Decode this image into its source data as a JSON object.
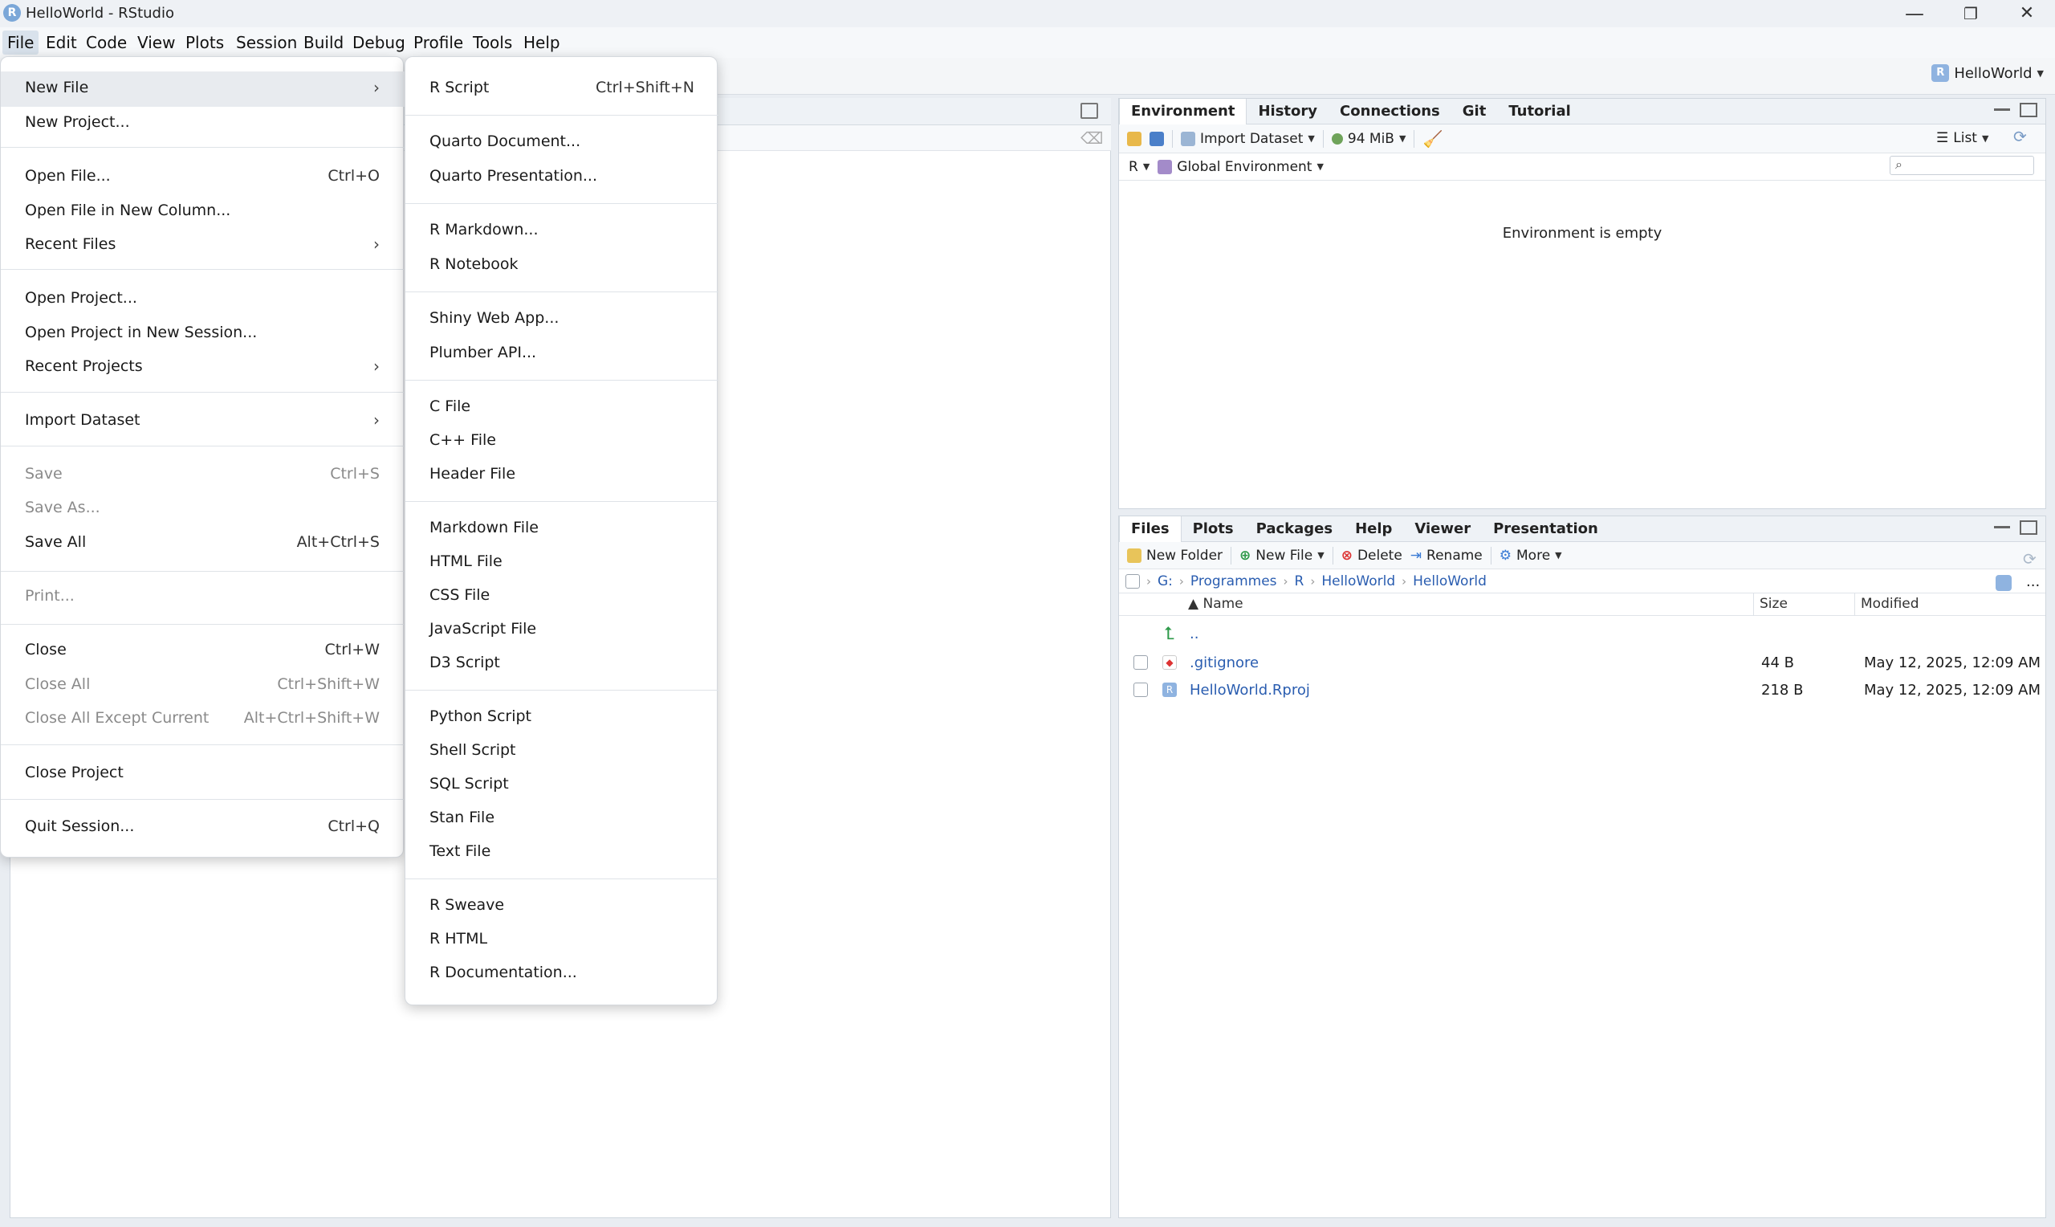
{
  "window": {
    "title": "HelloWorld - RStudio",
    "app_icon_letter": "R",
    "minimize": "—",
    "maximize": "❐",
    "close": "✕"
  },
  "menubar": [
    "File",
    "Edit",
    "Code",
    "View",
    "Plots",
    "Session",
    "Build",
    "Debug",
    "Profile",
    "Tools",
    "Help"
  ],
  "project": {
    "name": "HelloWorld"
  },
  "file_menu": {
    "items": [
      {
        "label": "New File",
        "shortcut": "",
        "submenu": true,
        "disabled": false
      },
      {
        "label": "New Project...",
        "shortcut": "",
        "submenu": false,
        "disabled": false
      },
      {
        "label": "Open File...",
        "shortcut": "Ctrl+O",
        "submenu": false,
        "disabled": false
      },
      {
        "label": "Open File in New Column...",
        "shortcut": "",
        "submenu": false,
        "disabled": false
      },
      {
        "label": "Recent Files",
        "shortcut": "",
        "submenu": true,
        "disabled": false
      },
      {
        "label": "Open Project...",
        "shortcut": "",
        "submenu": false,
        "disabled": false
      },
      {
        "label": "Open Project in New Session...",
        "shortcut": "",
        "submenu": false,
        "disabled": false
      },
      {
        "label": "Recent Projects",
        "shortcut": "",
        "submenu": true,
        "disabled": false
      },
      {
        "label": "Import Dataset",
        "shortcut": "",
        "submenu": true,
        "disabled": false
      },
      {
        "label": "Save",
        "shortcut": "Ctrl+S",
        "submenu": false,
        "disabled": true
      },
      {
        "label": "Save As...",
        "shortcut": "",
        "submenu": false,
        "disabled": true
      },
      {
        "label": "Save All",
        "shortcut": "Alt+Ctrl+S",
        "submenu": false,
        "disabled": false
      },
      {
        "label": "Print...",
        "shortcut": "",
        "submenu": false,
        "disabled": true
      },
      {
        "label": "Close",
        "shortcut": "Ctrl+W",
        "submenu": false,
        "disabled": false
      },
      {
        "label": "Close All",
        "shortcut": "Ctrl+Shift+W",
        "submenu": false,
        "disabled": true
      },
      {
        "label": "Close All Except Current",
        "shortcut": "Alt+Ctrl+Shift+W",
        "submenu": false,
        "disabled": true
      },
      {
        "label": "Close Project",
        "shortcut": "",
        "submenu": false,
        "disabled": false
      },
      {
        "label": "Quit Session...",
        "shortcut": "Ctrl+Q",
        "submenu": false,
        "disabled": false
      }
    ]
  },
  "new_file_submenu": {
    "items": [
      {
        "label": "R Script",
        "shortcut": "Ctrl+Shift+N"
      },
      {
        "label": "Quarto Document...",
        "shortcut": ""
      },
      {
        "label": "Quarto Presentation...",
        "shortcut": ""
      },
      {
        "label": "R Markdown...",
        "shortcut": ""
      },
      {
        "label": "R Notebook",
        "shortcut": ""
      },
      {
        "label": "Shiny Web App...",
        "shortcut": ""
      },
      {
        "label": "Plumber API...",
        "shortcut": ""
      },
      {
        "label": "C File",
        "shortcut": ""
      },
      {
        "label": "C++ File",
        "shortcut": ""
      },
      {
        "label": "Header File",
        "shortcut": ""
      },
      {
        "label": "Markdown File",
        "shortcut": ""
      },
      {
        "label": "HTML File",
        "shortcut": ""
      },
      {
        "label": "CSS File",
        "shortcut": ""
      },
      {
        "label": "JavaScript File",
        "shortcut": ""
      },
      {
        "label": "D3 Script",
        "shortcut": ""
      },
      {
        "label": "Python Script",
        "shortcut": ""
      },
      {
        "label": "Shell Script",
        "shortcut": ""
      },
      {
        "label": "SQL Script",
        "shortcut": ""
      },
      {
        "label": "Stan File",
        "shortcut": ""
      },
      {
        "label": "Text File",
        "shortcut": ""
      },
      {
        "label": "R Sweave",
        "shortcut": ""
      },
      {
        "label": "R HTML",
        "shortcut": ""
      },
      {
        "label": "R Documentation...",
        "shortcut": ""
      }
    ]
  },
  "env_pane": {
    "tabs": [
      "Environment",
      "History",
      "Connections",
      "Git",
      "Tutorial"
    ],
    "import_dataset": "Import Dataset",
    "memory": "94 MiB",
    "view_mode": "List",
    "language": "R",
    "scope": "Global Environment",
    "empty_message": "Environment is empty"
  },
  "files_pane": {
    "tabs": [
      "Files",
      "Plots",
      "Packages",
      "Help",
      "Viewer",
      "Presentation"
    ],
    "toolbar": {
      "new_folder": "New Folder",
      "new_file": "New File",
      "delete": "Delete",
      "rename": "Rename",
      "more": "More"
    },
    "breadcrumb": [
      "G:",
      "Programmes",
      "R",
      "HelloWorld",
      "HelloWorld"
    ],
    "more_dots": "...",
    "columns": {
      "name": "Name",
      "size": "Size",
      "modified": "Modified"
    },
    "parent_label": "..",
    "rows": [
      {
        "name": ".gitignore",
        "size": "44 B",
        "modified": "May 12, 2025, 12:09 AM",
        "icon": "gitignore-file-icon"
      },
      {
        "name": "HelloWorld.Rproj",
        "size": "218 B",
        "modified": "May 12, 2025, 12:09 AM",
        "icon": "rproj-file-icon"
      }
    ]
  },
  "colors": {
    "accent": "#2a5db0",
    "disabled": "#8a8a8a"
  }
}
